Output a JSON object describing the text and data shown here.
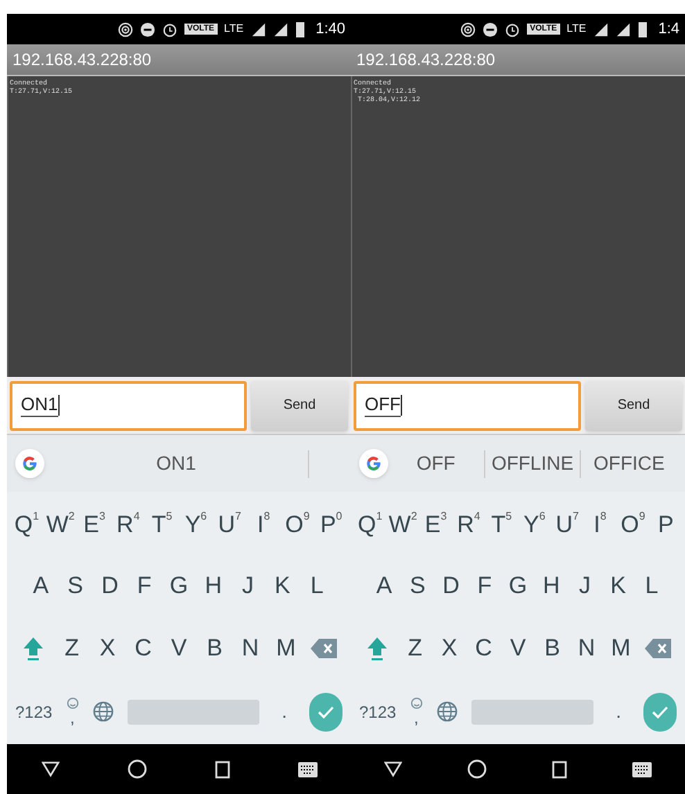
{
  "phones": [
    {
      "status": {
        "volte": "VOLTE",
        "network": "LTE",
        "time": "1:40"
      },
      "address": "192.168.43.228:80",
      "terminal_lines": [
        "Connected",
        "T:27.71,V:12.15"
      ],
      "input": {
        "value": "ON1",
        "focused": true
      },
      "send_label": "Send",
      "suggestions": [
        "ON1"
      ],
      "keyboard": {
        "row1": [
          {
            "key": "Q",
            "hint": "1"
          },
          {
            "key": "W",
            "hint": "2"
          },
          {
            "key": "E",
            "hint": "3"
          },
          {
            "key": "R",
            "hint": "4"
          },
          {
            "key": "T",
            "hint": "5"
          },
          {
            "key": "Y",
            "hint": "6"
          },
          {
            "key": "U",
            "hint": "7"
          },
          {
            "key": "I",
            "hint": "8"
          },
          {
            "key": "O",
            "hint": "9"
          },
          {
            "key": "P",
            "hint": "0"
          }
        ],
        "row2": [
          "A",
          "S",
          "D",
          "F",
          "G",
          "H",
          "J",
          "K",
          "L"
        ],
        "row3": [
          "Z",
          "X",
          "C",
          "V",
          "B",
          "N",
          "M"
        ],
        "symbols": "?123",
        "comma": ",",
        "period": "."
      }
    },
    {
      "status": {
        "volte": "VOLTE",
        "network": "LTE",
        "time": "1:4"
      },
      "address": "192.168.43.228:80",
      "terminal_lines": [
        "Connected",
        "T:27.71,V:12.15",
        " T:28.04,V:12.12"
      ],
      "input": {
        "value": "OFF",
        "focused": true
      },
      "send_label": "Send",
      "suggestions": [
        "OFF",
        "OFFLINE",
        "OFFICE"
      ],
      "keyboard": {
        "row1": [
          {
            "key": "Q",
            "hint": "1"
          },
          {
            "key": "W",
            "hint": "2"
          },
          {
            "key": "E",
            "hint": "3"
          },
          {
            "key": "R",
            "hint": "4"
          },
          {
            "key": "T",
            "hint": "5"
          },
          {
            "key": "Y",
            "hint": "6"
          },
          {
            "key": "U",
            "hint": "7"
          },
          {
            "key": "I",
            "hint": "8"
          },
          {
            "key": "O",
            "hint": "9"
          },
          {
            "key": "P"
          }
        ],
        "row2": [
          "A",
          "S",
          "D",
          "F",
          "G",
          "H",
          "J",
          "K",
          "L"
        ],
        "row3": [
          "Z",
          "X",
          "C",
          "V",
          "B",
          "N",
          "M"
        ],
        "symbols": "?123",
        "comma": ",",
        "period": "."
      }
    }
  ]
}
